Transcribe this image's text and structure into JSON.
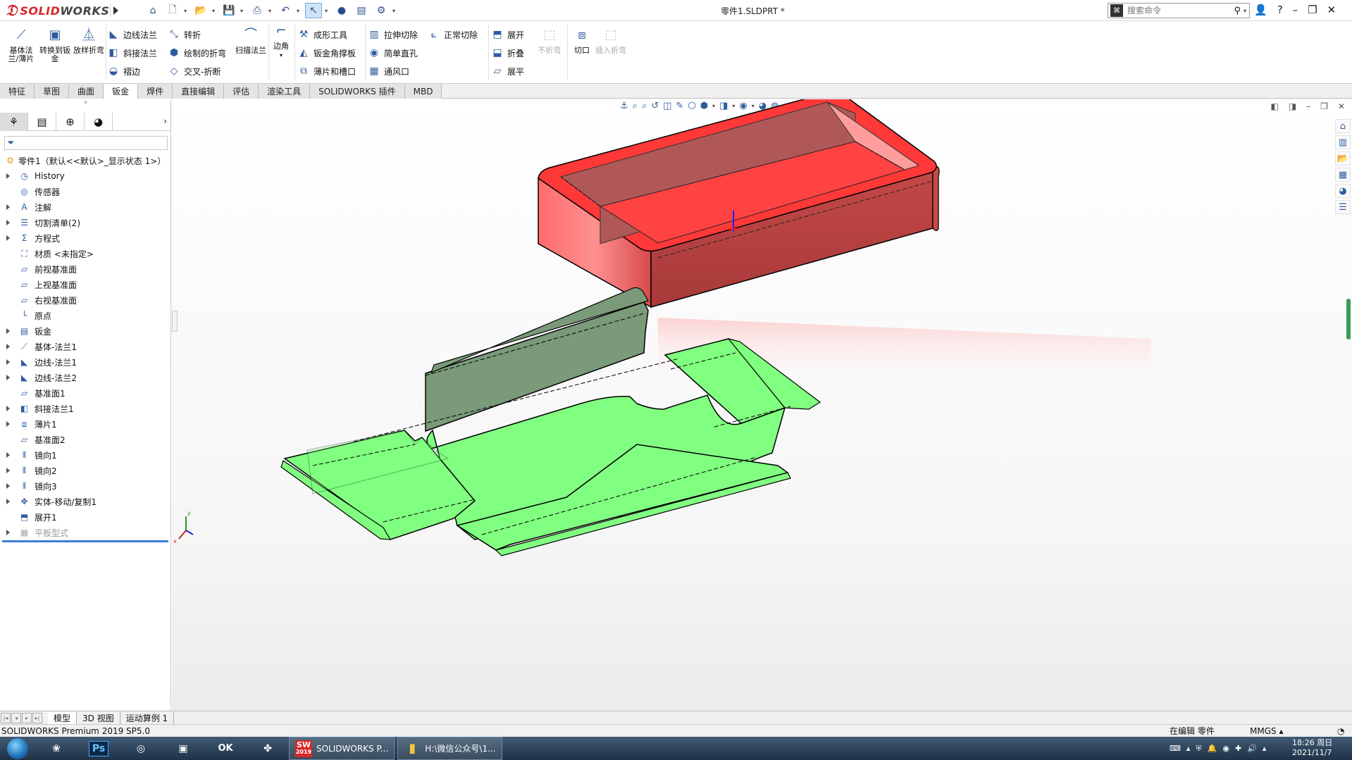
{
  "app": {
    "logo_ds": "ƻ",
    "logo_solid": "SOLID",
    "logo_works": "WORKS",
    "doc_title": "零件1.SLDPRT *"
  },
  "search": {
    "placeholder": "搜索命令"
  },
  "ribbon": {
    "big": [
      {
        "label": "基体法兰/薄片",
        "icon": "base-flange-icon"
      },
      {
        "label": "转换到钣金",
        "icon": "convert-sheetmetal-icon"
      },
      {
        "label": "放样折弯",
        "icon": "lofted-bend-icon"
      }
    ],
    "col1": [
      "边线法兰",
      "斜接法兰",
      "褶边"
    ],
    "col2": [
      "转折",
      "绘制的折弯",
      "交叉-折断"
    ],
    "sweep": "扫描法兰",
    "corner": "边角",
    "col3": [
      "成形工具",
      "钣金角撑板",
      "薄片和槽口"
    ],
    "col4": [
      "拉伸切除",
      "简单直孔",
      "通风口"
    ],
    "col4b": "正常切除",
    "col5": [
      "展开",
      "折叠",
      "展平"
    ],
    "nofold": "不折弯",
    "rip": "切口",
    "insert_bend": "插入折弯"
  },
  "tabs": [
    "特征",
    "草图",
    "曲面",
    "钣金",
    "焊件",
    "直接编辑",
    "评估",
    "渲染工具",
    "SOLIDWORKS 插件",
    "MBD"
  ],
  "active_tab": "钣金",
  "tree": {
    "root": "零件1（默认<<默认>_显示状态 1>）",
    "items": [
      {
        "label": "History",
        "expand": true
      },
      {
        "label": "传感器",
        "expand": false
      },
      {
        "label": "注解",
        "expand": true
      },
      {
        "label": "切割清单(2)",
        "expand": true
      },
      {
        "label": "方程式",
        "expand": true
      },
      {
        "label": "材质 <未指定>",
        "expand": false
      },
      {
        "label": "前视基准面",
        "expand": false
      },
      {
        "label": "上视基准面",
        "expand": false
      },
      {
        "label": "右视基准面",
        "expand": false
      },
      {
        "label": "原点",
        "expand": false
      },
      {
        "label": "钣金",
        "expand": true
      },
      {
        "label": "基体-法兰1",
        "expand": true
      },
      {
        "label": "边线-法兰1",
        "expand": true
      },
      {
        "label": "边线-法兰2",
        "expand": true
      },
      {
        "label": "基准面1",
        "expand": false
      },
      {
        "label": "斜接法兰1",
        "expand": true
      },
      {
        "label": "薄片1",
        "expand": true
      },
      {
        "label": "基准面2",
        "expand": false
      },
      {
        "label": "镜向1",
        "expand": true
      },
      {
        "label": "镜向2",
        "expand": true
      },
      {
        "label": "镜向3",
        "expand": true
      },
      {
        "label": "实体-移动/复制1",
        "expand": true
      },
      {
        "label": "展开1",
        "expand": false
      },
      {
        "label": "平板型式",
        "expand": true,
        "disabled": true
      }
    ]
  },
  "bottom_tabs": [
    "模型",
    "3D 视图",
    "运动算例 1"
  ],
  "status": {
    "product": "SOLIDWORKS Premium 2019 SP5.0",
    "mode": "在编辑 零件",
    "units": "MMGS"
  },
  "taskbar": {
    "sw_badge": "2019",
    "sw_window": "SOLIDWORKS P...",
    "folder_window": "H:\\微信公众号\\1...",
    "time": "18:26 周日",
    "date": "2021/11/7",
    "ps": "Ps",
    "ok": "OK"
  },
  "colors": {
    "box": "#ff4545",
    "flat": "#80ff80",
    "flap": "#7a9a7a",
    "accent": "#d8262a"
  }
}
